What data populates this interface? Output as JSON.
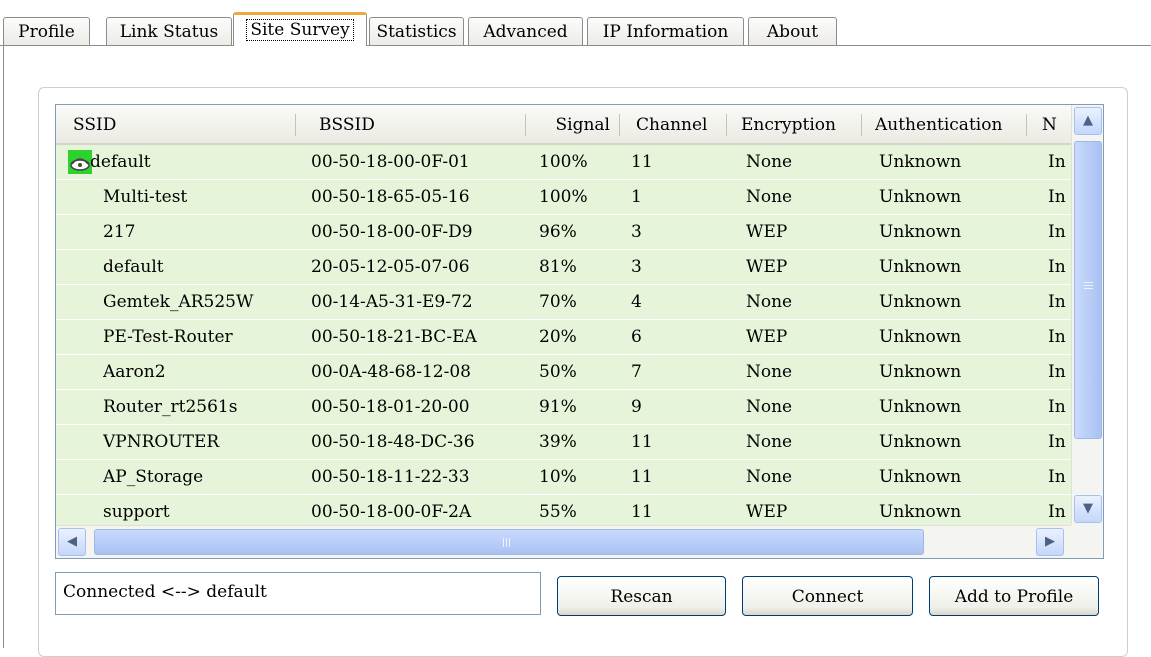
{
  "tabs": [
    {
      "label": "Profile",
      "active": false
    },
    {
      "label": "Link Status",
      "active": false
    },
    {
      "label": "Site Survey",
      "active": true
    },
    {
      "label": "Statistics",
      "active": false
    },
    {
      "label": "Advanced",
      "active": false
    },
    {
      "label": "IP Information",
      "active": false
    },
    {
      "label": "About",
      "active": false
    }
  ],
  "table": {
    "columns": [
      "SSID",
      "BSSID",
      "Signal",
      "Channel",
      "Encryption",
      "Authentication",
      "N"
    ],
    "rows": [
      {
        "ssid": "default",
        "bssid": "00-50-18-00-0F-01",
        "signal": "100%",
        "channel": "11",
        "encryption": "None",
        "authentication": "Unknown",
        "network": "In",
        "connected": true
      },
      {
        "ssid": "Multi-test",
        "bssid": "00-50-18-65-05-16",
        "signal": "100%",
        "channel": "1",
        "encryption": "None",
        "authentication": "Unknown",
        "network": "In"
      },
      {
        "ssid": "217",
        "bssid": "00-50-18-00-0F-D9",
        "signal": "96%",
        "channel": "3",
        "encryption": "WEP",
        "authentication": "Unknown",
        "network": "In"
      },
      {
        "ssid": "default",
        "bssid": "20-05-12-05-07-06",
        "signal": "81%",
        "channel": "3",
        "encryption": "WEP",
        "authentication": "Unknown",
        "network": "In"
      },
      {
        "ssid": "Gemtek_AR525W",
        "bssid": "00-14-A5-31-E9-72",
        "signal": "70%",
        "channel": "4",
        "encryption": "None",
        "authentication": "Unknown",
        "network": "In"
      },
      {
        "ssid": "PE-Test-Router",
        "bssid": "00-50-18-21-BC-EA",
        "signal": "20%",
        "channel": "6",
        "encryption": "WEP",
        "authentication": "Unknown",
        "network": "In"
      },
      {
        "ssid": "Aaron2",
        "bssid": "00-0A-48-68-12-08",
        "signal": "50%",
        "channel": "7",
        "encryption": "None",
        "authentication": "Unknown",
        "network": "In"
      },
      {
        "ssid": "Router_rt2561s",
        "bssid": "00-50-18-01-20-00",
        "signal": "91%",
        "channel": "9",
        "encryption": "None",
        "authentication": "Unknown",
        "network": "In"
      },
      {
        "ssid": "VPNROUTER",
        "bssid": "00-50-18-48-DC-36",
        "signal": "39%",
        "channel": "11",
        "encryption": "None",
        "authentication": "Unknown",
        "network": "In"
      },
      {
        "ssid": "AP_Storage",
        "bssid": "00-50-18-11-22-33",
        "signal": "10%",
        "channel": "11",
        "encryption": "None",
        "authentication": "Unknown",
        "network": "In"
      },
      {
        "ssid": "support",
        "bssid": "00-50-18-00-0F-2A",
        "signal": "55%",
        "channel": "11",
        "encryption": "WEP",
        "authentication": "Unknown",
        "network": "In"
      }
    ]
  },
  "status": {
    "text": "Connected <--> default"
  },
  "buttons": {
    "rescan": "Rescan",
    "connect": "Connect",
    "add_to_profile": "Add to Profile"
  },
  "icons": {
    "connected": "wireless-connected-icon"
  },
  "colors": {
    "row_bg": "#e6f5d9",
    "active_tab_accent": "#f2a73b",
    "scroll_thumb": "#b6cbf7"
  }
}
